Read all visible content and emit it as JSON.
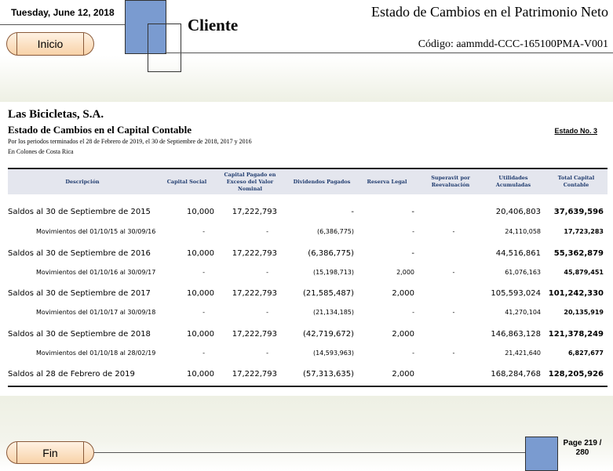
{
  "header": {
    "date": "Tuesday, June 12, 2018",
    "client": "Cliente",
    "report_title": "Estado de Cambios en el Patrimonio Neto",
    "code": "Código: aammdd-CCC-165100PMA-V001"
  },
  "nav": {
    "start_label": "Inicio",
    "end_label": "Fin"
  },
  "footer": {
    "page": "Page 219 /",
    "page_total": "280"
  },
  "document": {
    "company": "Las Bicicletas, S.A.",
    "statement": "Estado de Cambios en el Capital Contable",
    "statement_no": "Estado No. 3",
    "period": "Por los periodos terminados el 28 de Febrero de 2019, el 30 de Septiembre de 2018, 2017 y 2016",
    "currency": "En Colones de Costa Rica",
    "columns": {
      "descripcion": "Descripción",
      "capital_social": "Capital Social",
      "capital_pagado": "Capital Pagado en Exceso del Valor Nominal",
      "dividendos": "Dividendos Pagados",
      "reserva": "Reserva Legal",
      "superavit": "Superavit por Reevaluación",
      "utilidades": "Utilidades Acumuladas",
      "total": "Total Capital Contable"
    },
    "rows": [
      {
        "desc": "Saldos al 30 de Septiembre de 2015",
        "capital_social": "10,000",
        "capital_pagado": "17,222,793",
        "dividendos": "-",
        "reserva": "-",
        "superavit": "",
        "utilidades": "20,406,803",
        "total": "37,639,596"
      },
      {
        "desc": "Movimientos del 01/10/15 al 30/09/16",
        "capital_social": "-",
        "capital_pagado": "-",
        "dividendos": "(6,386,775)",
        "reserva": "-",
        "superavit": "-",
        "utilidades": "24,110,058",
        "total": "17,723,283"
      },
      {
        "desc": "Saldos al 30 de Septiembre de 2016",
        "capital_social": "10,000",
        "capital_pagado": "17,222,793",
        "dividendos": "(6,386,775)",
        "reserva": "-",
        "superavit": "",
        "utilidades": "44,516,861",
        "total": "55,362,879"
      },
      {
        "desc": "Movimientos del 01/10/16 al 30/09/17",
        "capital_social": "-",
        "capital_pagado": "-",
        "dividendos": "(15,198,713)",
        "reserva": "2,000",
        "superavit": "-",
        "utilidades": "61,076,163",
        "total": "45,879,451"
      },
      {
        "desc": "Saldos al 30 de Septiembre de 2017",
        "capital_social": "10,000",
        "capital_pagado": "17,222,793",
        "dividendos": "(21,585,487)",
        "reserva": "2,000",
        "superavit": "",
        "utilidades": "105,593,024",
        "total": "101,242,330"
      },
      {
        "desc": "Movimientos del 01/10/17 al 30/09/18",
        "capital_social": "-",
        "capital_pagado": "-",
        "dividendos": "(21,134,185)",
        "reserva": "-",
        "superavit": "-",
        "utilidades": "41,270,104",
        "total": "20,135,919"
      },
      {
        "desc": "Saldos al 30 de Septiembre de 2018",
        "capital_social": "10,000",
        "capital_pagado": "17,222,793",
        "dividendos": "(42,719,672)",
        "reserva": "2,000",
        "superavit": "",
        "utilidades": "146,863,128",
        "total": "121,378,249"
      },
      {
        "desc": "Movimientos del 01/10/18 al 28/02/19",
        "capital_social": "-",
        "capital_pagado": "-",
        "dividendos": "(14,593,963)",
        "reserva": "-",
        "superavit": "-",
        "utilidades": "21,421,640",
        "total": "6,827,677"
      },
      {
        "desc": "Saldos al 28 de Febrero de 2019",
        "capital_social": "10,000",
        "capital_pagado": "17,222,793",
        "dividendos": "(57,313,635)",
        "reserva": "2,000",
        "superavit": "",
        "utilidades": "168,284,768",
        "total": "128,205,926"
      }
    ]
  }
}
